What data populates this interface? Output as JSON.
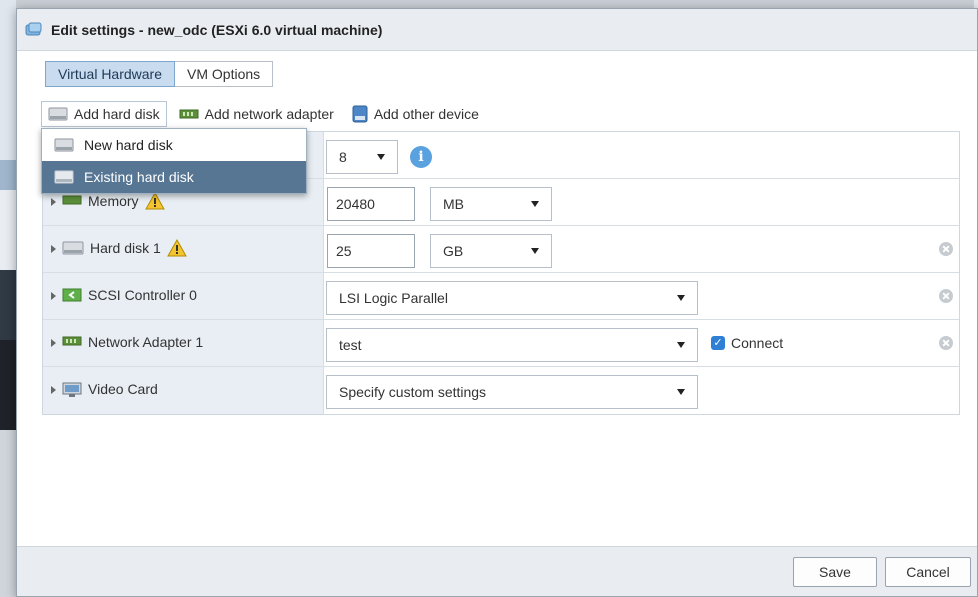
{
  "dialog": {
    "title": "Edit settings - new_odc (ESXi 6.0 virtual machine)"
  },
  "tabs": [
    {
      "label": "Virtual Hardware",
      "active": true
    },
    {
      "label": "VM Options",
      "active": false
    }
  ],
  "toolbar": {
    "add_hard_disk": "Add hard disk",
    "add_network_adapter": "Add network adapter",
    "add_other_device": "Add other device"
  },
  "dropdown": {
    "items": [
      {
        "label": "New hard disk",
        "active": false
      },
      {
        "label": "Existing hard disk",
        "active": true
      }
    ]
  },
  "hardware": {
    "cpu": {
      "value": "8"
    },
    "memory": {
      "label": "Memory",
      "value": "20480",
      "unit": "MB"
    },
    "hard_disk": {
      "label": "Hard disk 1",
      "value": "25",
      "unit": "GB"
    },
    "scsi": {
      "label": "SCSI Controller 0",
      "value": "LSI Logic Parallel"
    },
    "network": {
      "label": "Network Adapter 1",
      "value": "test",
      "connect_label": "Connect",
      "connected": true
    },
    "video": {
      "label": "Video Card",
      "value": "Specify custom settings"
    }
  },
  "footer": {
    "save": "Save",
    "cancel": "Cancel"
  },
  "colors": {
    "accent": "#567694",
    "tab_active": "#c9dbee",
    "warning": "#f4c430",
    "info": "#5aa1e0",
    "checkbox": "#2f7fd6"
  },
  "icons": {
    "title": "vm-icon",
    "disk": "hard-disk-icon",
    "network": "network-adapter-icon",
    "other": "other-device-icon",
    "warning": "warning-icon",
    "info": "info-icon",
    "remove": "remove-icon",
    "scsi": "scsi-controller-icon",
    "video": "video-card-icon"
  }
}
